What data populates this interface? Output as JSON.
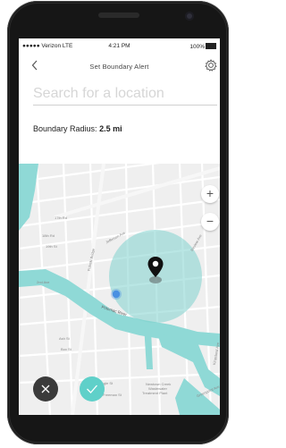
{
  "status_bar": {
    "carrier": "●●●●● Verizon LTE",
    "time": "4:21 PM",
    "battery": "100%"
  },
  "header": {
    "back_icon": "chevron-left-icon",
    "title": "Set Boundary Alert",
    "settings_icon": "gear-icon"
  },
  "search": {
    "placeholder": "Search for a location"
  },
  "boundary": {
    "label": "Boundary Radius:",
    "value": "2.5 mi"
  },
  "map": {
    "zoom_in": "+",
    "zoom_out": "−",
    "pin_icon": "location-pin-icon",
    "current_location_icon": "blue-dot-icon",
    "labels": {
      "street_17th": "17th Rd",
      "street_18th": "18th Rd",
      "street_19th": "19th St",
      "jefferson": "Jefferson Ave",
      "potomac": "Potomac River",
      "pulaski": "Pulaski Bridge",
      "ash": "Ash St",
      "box": "Box St",
      "newtown": "Newtown Creek",
      "wastewater": "Wastewater",
      "treatment": "Treatment Plant",
      "greenpoint": "Greenpoint Ave",
      "eagle": "Eagle St",
      "review": "Review Ave",
      "freeman": "Freeman St",
      "kingsland": "Kingsland Ave",
      "ave_2nd": "2nd Ave"
    },
    "accent_color": "#5fd0c9",
    "water_color": "#8fd9d6",
    "radius_color": "#7fd1cd"
  },
  "actions": {
    "cancel_icon": "close-icon",
    "confirm_icon": "check-icon"
  }
}
